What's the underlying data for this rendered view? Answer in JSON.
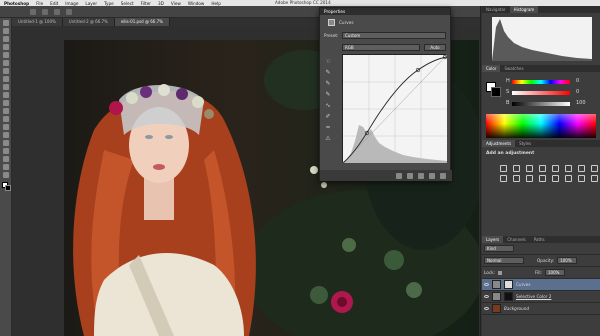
{
  "menubar": {
    "items": [
      "Photoshop",
      "File",
      "Edit",
      "Image",
      "Layer",
      "Type",
      "Select",
      "Filter",
      "3D",
      "View",
      "Window",
      "Help"
    ],
    "title": "Adobe Photoshop CC 2014"
  },
  "doctabs": [
    {
      "label": "Untitled-1 @ 100%",
      "active": false
    },
    {
      "label": "Untitled-2 @ 66.7%",
      "active": false
    },
    {
      "label": "ellis-01.psd @ 66.7%",
      "active": true
    }
  ],
  "properties": {
    "tab_label": "Properties",
    "panel_title": "Curves",
    "preset_label": "Preset:",
    "preset_value": "Custom",
    "channel_value": "RGB",
    "auto_label": "Auto"
  },
  "right_panel": {
    "navigator_tab": "Navigator",
    "histogram_tab": "Histogram",
    "color_tab": "Color",
    "swatches_tab": "Swatches",
    "color_values": [
      "0",
      "0",
      "100"
    ],
    "color_labels": [
      "H",
      "S",
      "B"
    ],
    "adjustments_tab": "Adjustments",
    "styles_tab": "Styles",
    "add_adjustment": "Add an adjustment"
  },
  "layers": {
    "tabs": [
      "Layers",
      "Channels",
      "Paths"
    ],
    "kind_label": "Kind",
    "blend_mode": "Normal",
    "opacity_label": "Opacity:",
    "opacity_value": "100%",
    "lock_label": "Lock:",
    "fill_label": "Fill:",
    "fill_value": "100%",
    "items": [
      {
        "name": "Curves",
        "selected": true
      },
      {
        "name": "Selective Color 2",
        "selected": false
      },
      {
        "name": "Background",
        "selected": false
      }
    ]
  },
  "colors": {
    "accent_selection": "#5b6f8e",
    "panel_bg": "#4a4a4a"
  }
}
